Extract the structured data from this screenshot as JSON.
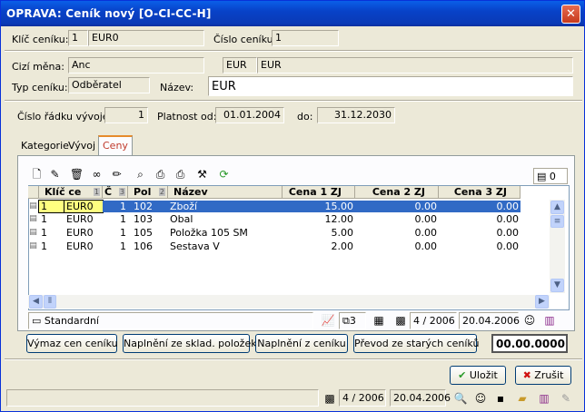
{
  "window": {
    "title": "OPRAVA: Ceník nový [O-CI-CC-H]",
    "close": "✕"
  },
  "form": {
    "klic_label": "Klíč ceníku:",
    "klic_num": "1",
    "klic_code": "EUR0",
    "cislo_label": "Číslo ceníku:",
    "cislo_value": "1",
    "mena_label": "Cizí měna:",
    "mena_value": "Anc",
    "mena_code1": "EUR",
    "mena_code2": "EUR",
    "typ_label": "Typ ceníku:",
    "typ_value": "Odběratel",
    "nazev_label": "Název:",
    "nazev_value": "EUR",
    "radek_label": "Číslo řádku vývoje:",
    "radek_value": "1",
    "platnost_label": "Platnost od:",
    "platnost_od": "01.01.2004",
    "do_label": "do:",
    "platnost_do": "31.12.2030"
  },
  "tabs": [
    "Kategorie",
    "Vývoj",
    "Ceny"
  ],
  "grid": {
    "counter": "0",
    "columns": [
      {
        "label": "Klíč ce",
        "idx": "1"
      },
      {
        "label": "Č",
        "idx": "3"
      },
      {
        "label": "Pol",
        "idx": "2"
      },
      {
        "label": "Název",
        "idx": ""
      },
      {
        "label": "Cena 1 ZJ",
        "idx": ""
      },
      {
        "label": "Cena 2 ZJ",
        "idx": ""
      },
      {
        "label": "Cena 3 ZJ",
        "idx": ""
      }
    ],
    "rows": [
      {
        "a": "1",
        "b": "EUR0",
        "c": "1",
        "d": "102",
        "e": "Zboží",
        "f": "15.00",
        "g": "0.00",
        "h": "0.00"
      },
      {
        "a": "1",
        "b": "EUR0",
        "c": "1",
        "d": "103",
        "e": "Obal",
        "f": "12.00",
        "g": "0.00",
        "h": "0.00"
      },
      {
        "a": "1",
        "b": "EUR0",
        "c": "1",
        "d": "105",
        "e": "Položka 105 SM",
        "f": "5.00",
        "g": "0.00",
        "h": "0.00"
      },
      {
        "a": "1",
        "b": "EUR0",
        "c": "1",
        "d": "106",
        "e": "Sestava V",
        "f": "2.00",
        "g": "0.00",
        "h": "0.00"
      }
    ]
  },
  "gridstatus": {
    "layout": "Standardní",
    "count": "3",
    "period": "4 / 2006",
    "date": "20.04.2006"
  },
  "actions": {
    "vymaz": "Výmaz cen ceníku",
    "naplneni_sklad": "Naplnění ze sklad. položek",
    "naplneni_cenik": "Naplnění z ceníku",
    "prevod": "Převod ze starých ceníků",
    "amount": "00.00.0000"
  },
  "buttons": {
    "ulozit": "Uložit",
    "zrusit": "Zrušit"
  },
  "statusbar": {
    "period": "4 / 2006",
    "date": "20.04.2006"
  }
}
